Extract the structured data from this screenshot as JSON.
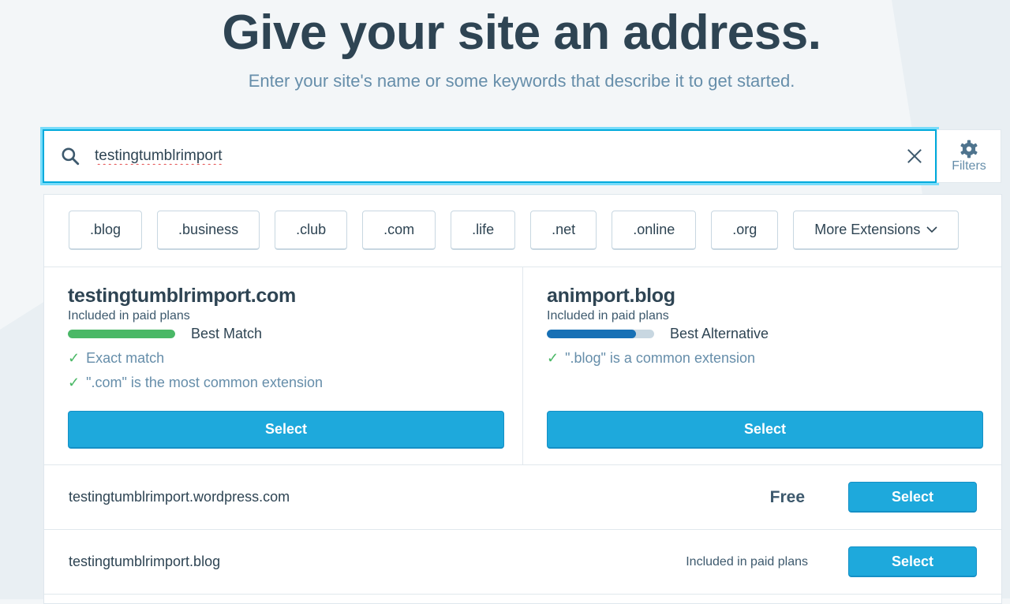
{
  "header": {
    "title": "Give your site an address.",
    "subtitle": "Enter your site's name or some keywords that describe it to get started."
  },
  "search": {
    "value": "testingtumblrimport",
    "filters_label": "Filters"
  },
  "extensions": [
    ".blog",
    ".business",
    ".club",
    ".com",
    ".life",
    ".net",
    ".online",
    ".org"
  ],
  "more_extensions": "More Extensions",
  "featured": [
    {
      "domain": "testingtumblrimport.com",
      "price": "Included in paid plans",
      "rank_label": "Best Match",
      "rank_fraction": 1.0,
      "rank_color": "#4ab866",
      "checks": [
        "Exact match",
        "\".com\" is the most common extension"
      ],
      "select": "Select"
    },
    {
      "domain": "animport.blog",
      "price": "Included in paid plans",
      "rank_label": "Best Alternative",
      "rank_fraction": 0.83,
      "rank_color": "#1770b5",
      "checks": [
        "\".blog\" is a common extension"
      ],
      "select": "Select"
    }
  ],
  "results": [
    {
      "domain": "testingtumblrimport.wordpress.com",
      "price": "Free",
      "select": "Select"
    },
    {
      "domain": "testingtumblrimport.blog",
      "price": "Included in paid plans",
      "select": "Select"
    }
  ]
}
